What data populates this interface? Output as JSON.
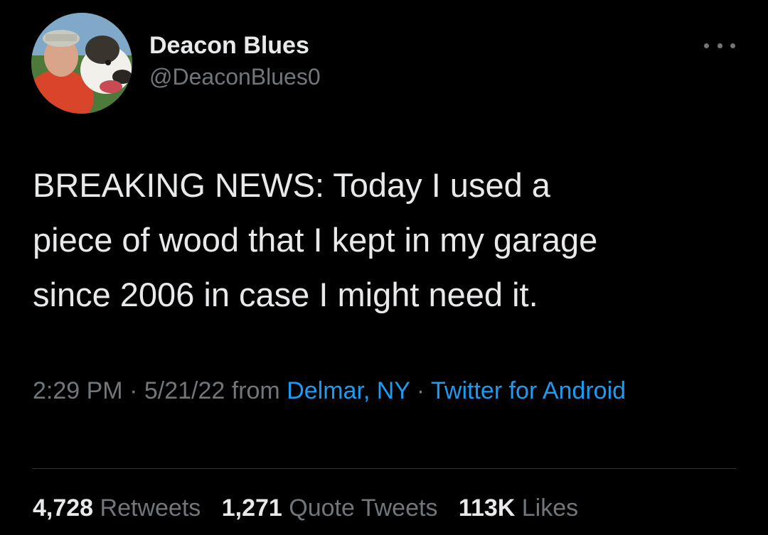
{
  "tweet": {
    "author": {
      "display_name": "Deacon Blues",
      "handle": "@DeaconBlues0",
      "avatar": "profile-photo-man-with-dog"
    },
    "more_icon": "more-horizontal-icon",
    "text_lines": [
      "BREAKING NEWS: Today I used a",
      "piece of wood that I kept in my garage",
      "since 2006 in case I might need it."
    ],
    "meta": {
      "time": "2:29 PM",
      "sep1": " · ",
      "date": "5/21/22",
      "from": " from ",
      "location": "Delmar, NY",
      "sep2": " · ",
      "client": "Twitter for Android"
    },
    "stats": {
      "retweets_count": "4,728",
      "retweets_label": "Retweets",
      "quotes_count": "1,271",
      "quotes_label": "Quote Tweets",
      "likes_count": "113K",
      "likes_label": "Likes"
    },
    "colors": {
      "background": "#000000",
      "primary_text": "#e7e9ea",
      "secondary_text": "#71767b",
      "link": "#1d9bf0",
      "divider": "#2f3336"
    }
  }
}
